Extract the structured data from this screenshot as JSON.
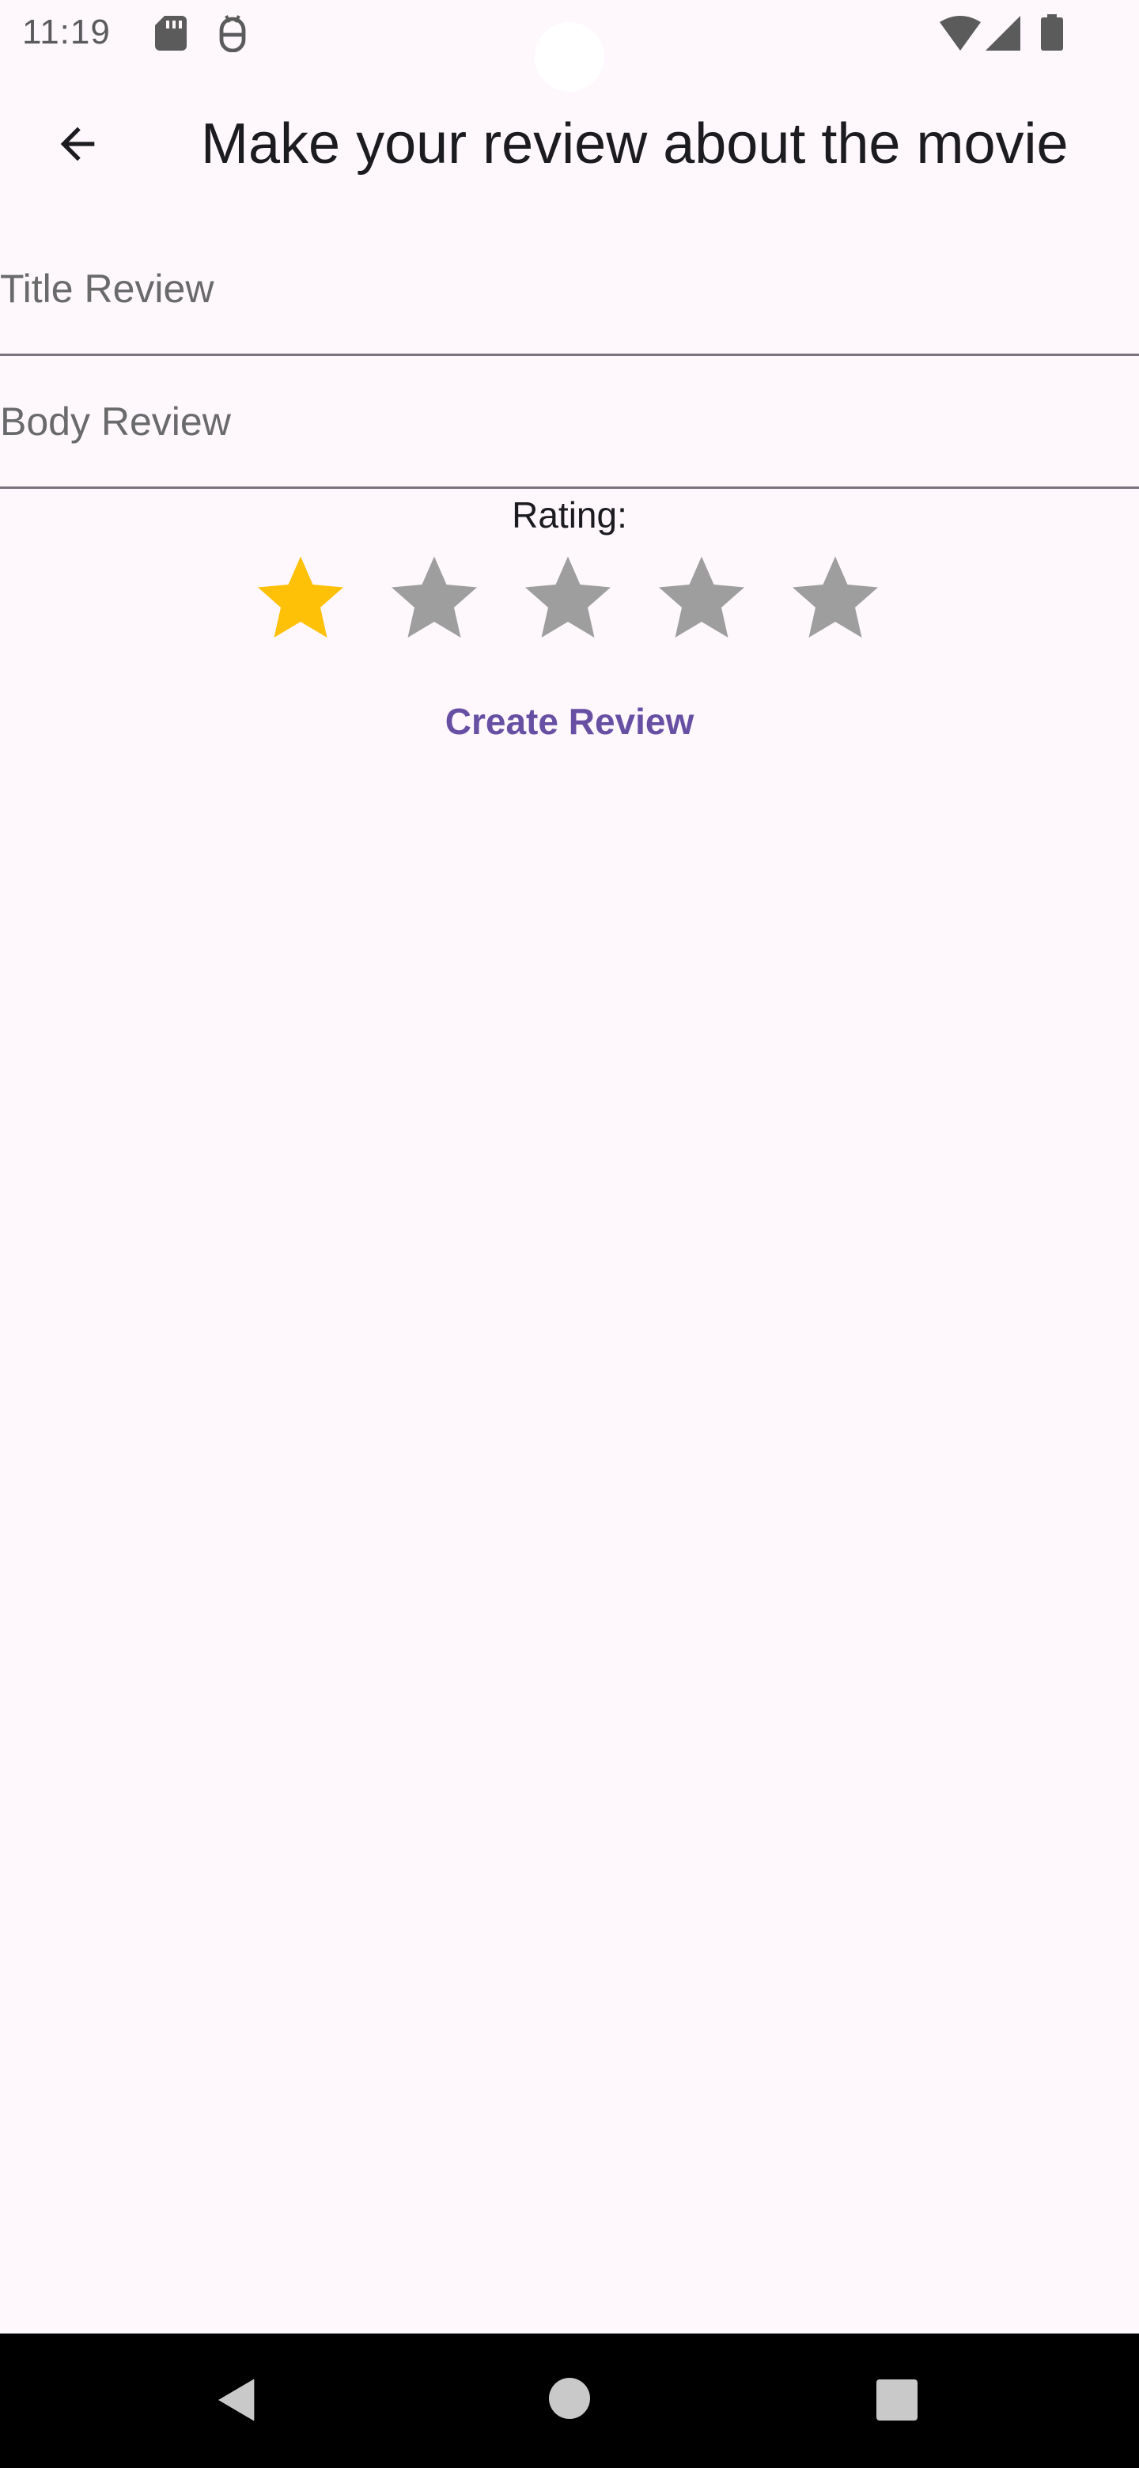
{
  "status_bar": {
    "time": "11:19",
    "icons": [
      "sd-card-icon",
      "debug-icon",
      "wifi-icon",
      "signal-icon",
      "battery-icon"
    ]
  },
  "app_bar": {
    "back_icon": "arrow-back-icon",
    "title": "Make your review about the movie"
  },
  "form": {
    "title_placeholder": "Title Review",
    "title_value": "",
    "body_placeholder": "Body Review",
    "body_value": "",
    "rating_label": "Rating:",
    "rating_value": 1,
    "rating_max": 5,
    "create_label": "Create Review"
  },
  "colors": {
    "background": "#FEF7FC",
    "star_active": "#FFC107",
    "star_inactive": "#9E9E9E",
    "accent": "#6750A4",
    "nav_bar": "#000000"
  },
  "nav_bar": {
    "icons": [
      "nav-back-icon",
      "nav-home-icon",
      "nav-recents-icon"
    ]
  }
}
